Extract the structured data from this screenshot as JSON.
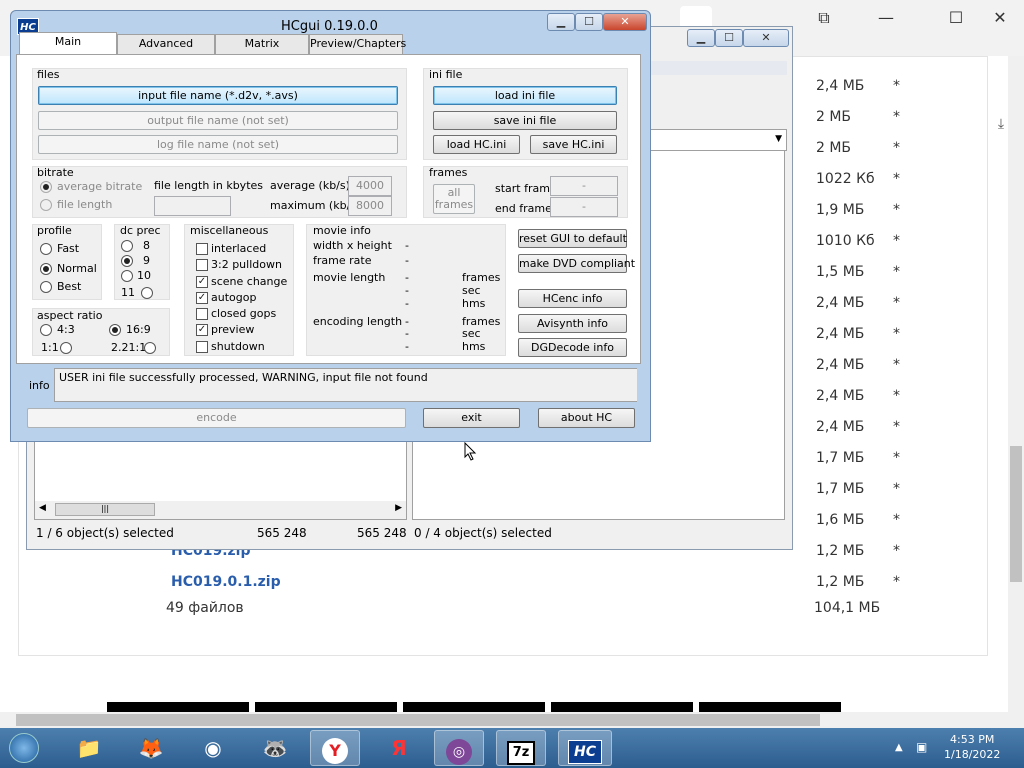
{
  "browser": {
    "files": [
      {
        "size": "2,4 МБ",
        "star": "*"
      },
      {
        "size": "2 МБ",
        "star": "*"
      },
      {
        "size": "2 МБ",
        "star": "*"
      },
      {
        "size": "1022 Кб",
        "star": "*"
      },
      {
        "size": "1,9 МБ",
        "star": "*"
      },
      {
        "size": "1010 Кб",
        "star": "*"
      },
      {
        "size": "1,5 МБ",
        "star": "*"
      },
      {
        "size": "2,4 МБ",
        "star": "*"
      },
      {
        "size": "2,4 МБ",
        "star": "*"
      },
      {
        "size": "2,4 МБ",
        "star": "*"
      },
      {
        "size": "2,4 МБ",
        "star": "*"
      },
      {
        "size": "2,4 МБ",
        "star": "*"
      },
      {
        "size": "1,7 МБ",
        "star": "*"
      },
      {
        "size": "1,7 МБ",
        "star": "*"
      },
      {
        "size": "1,6 МБ",
        "star": "*"
      },
      {
        "size": "1,2 МБ",
        "star": "*"
      },
      {
        "size": "1,2 МБ",
        "star": "*"
      }
    ],
    "links": [
      "HC019.zip",
      "HC019.0.1.zip"
    ],
    "total_label": "49 файлов",
    "total_size": "104,1 МБ"
  },
  "explorer": {
    "status_left": "1 / 6 object(s) selected",
    "status_size1": "565 248",
    "status_size2": "565 248",
    "status_right": "0 / 4 object(s) selected"
  },
  "dialog": {
    "title": "HCgui 0.19.0.0",
    "logo": "HC",
    "tabs": [
      "Main",
      "Advanced",
      "Matrix",
      "Preview/Chapters"
    ],
    "files": {
      "label": "files",
      "input_btn": "input file name (*.d2v, *.avs)",
      "output_btn": "output file name (not set)",
      "log_btn": "log file name (not set)"
    },
    "ini": {
      "label": "ini file",
      "load": "load ini file",
      "save": "save ini file",
      "load_hc": "load HC.ini",
      "save_hc": "save HC.ini"
    },
    "bitrate": {
      "label": "bitrate",
      "avg": "average bitrate",
      "filelen": "file length",
      "filelen_kb": "file length in kbytes",
      "average_kbs": "average (kb/s)",
      "average_val": "4000",
      "maximum_kbs": "maximum (kb/s)",
      "maximum_val": "8000"
    },
    "frames": {
      "label": "frames",
      "all": "all frames",
      "start": "start frame",
      "start_val": "-",
      "end": "end frame",
      "end_val": "-"
    },
    "profile": {
      "label": "profile",
      "fast": "Fast",
      "normal": "Normal",
      "best": "Best"
    },
    "dcprec": {
      "label": "dc prec",
      "v8": "8",
      "v9": "9",
      "v10": "10",
      "v11": "11"
    },
    "aspect": {
      "label": "aspect ratio",
      "a43": "4:3",
      "a169": "16:9",
      "a11": "1:1",
      "a221": "2.21:1"
    },
    "misc": {
      "label": "miscellaneous",
      "interlaced": "interlaced",
      "pulldown": "3:2 pulldown",
      "scene": "scene change",
      "autogop": "autogop",
      "closed": "closed gops",
      "preview": "preview",
      "shutdown": "shutdown"
    },
    "movie": {
      "label": "movie info",
      "wh": "width x height",
      "fr": "frame rate",
      "ml": "movie length",
      "el": "encoding length",
      "dash": "-",
      "frames": "frames",
      "sec": "sec",
      "hms": "hms"
    },
    "right_buttons": {
      "reset": "reset GUI to default",
      "dvd": "make DVD compliant",
      "hcenc": "HCenc info",
      "avisynth": "Avisynth info",
      "dgdecode": "DGDecode info"
    },
    "info_label": "info",
    "info_text": "USER ini file successfully processed, WARNING, input file not found",
    "encode": "encode",
    "exit": "exit",
    "about": "about HC"
  },
  "taskbar": {
    "time": "4:53 PM",
    "date": "1/18/2022"
  }
}
